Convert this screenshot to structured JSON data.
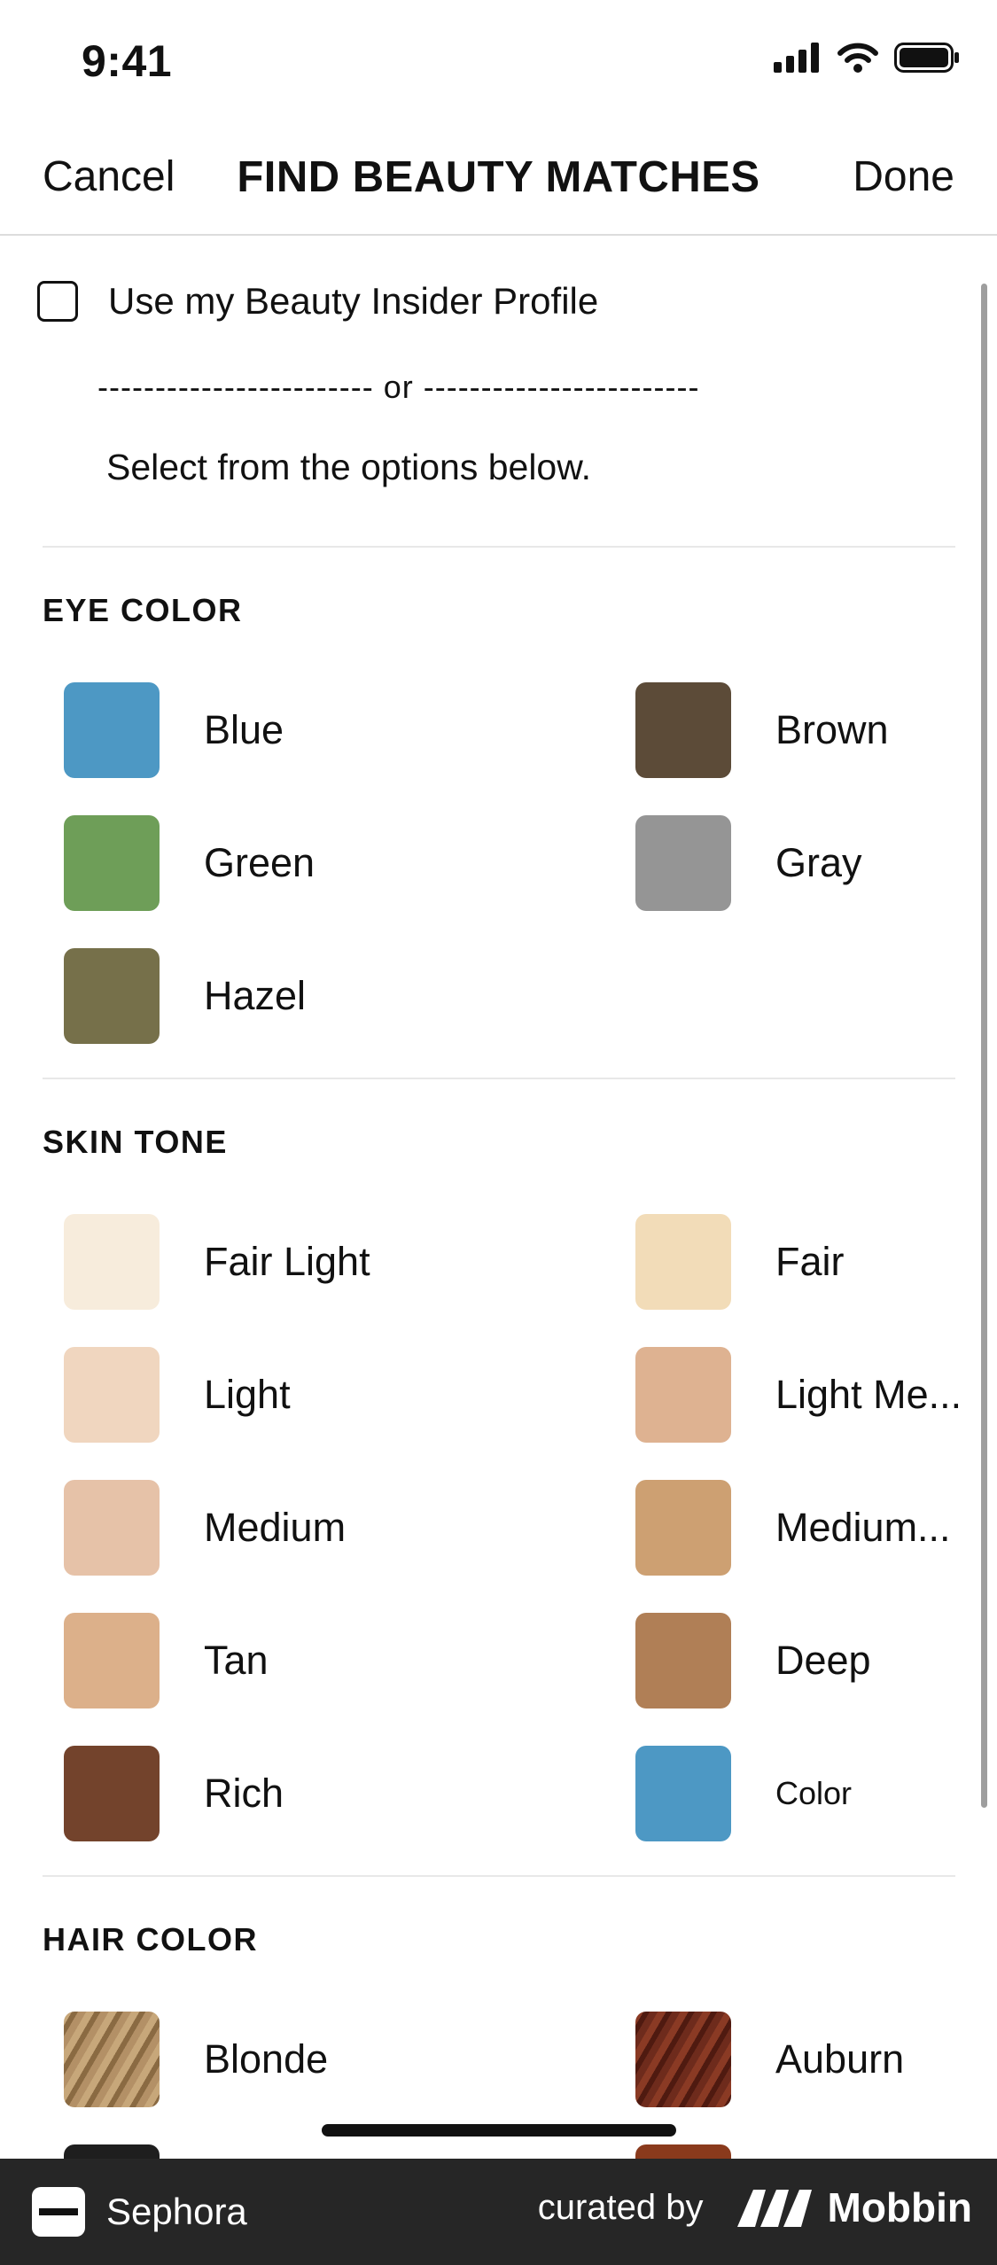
{
  "status_bar": {
    "time": "9:41"
  },
  "nav": {
    "cancel": "Cancel",
    "title": "FIND BEAUTY MATCHES",
    "done": "Done"
  },
  "profile": {
    "checkbox_label": "Use my Beauty Insider Profile",
    "divider_text": "------------------------ or ------------------------",
    "instruction": "Select from the options below."
  },
  "eye_color": {
    "title": "EYE COLOR",
    "options": [
      {
        "label": "Blue",
        "color": "#4d98c4"
      },
      {
        "label": "Brown",
        "color": "#5c4b38"
      },
      {
        "label": "Green",
        "color": "#6e9e58"
      },
      {
        "label": "Gray",
        "color": "#959595"
      },
      {
        "label": "Hazel",
        "color": "#76704a"
      }
    ]
  },
  "skin_tone": {
    "title": "SKIN TONE",
    "options": [
      {
        "label": "Fair Light",
        "color": "#f7ecdc"
      },
      {
        "label": "Fair",
        "color": "#f2dcb8"
      },
      {
        "label": "Light",
        "color": "#f0d6bf"
      },
      {
        "label": "Light Me...",
        "color": "#deb291"
      },
      {
        "label": "Medium",
        "color": "#e6c2a8"
      },
      {
        "label": "Medium...",
        "color": "#cda072"
      },
      {
        "label": "Tan",
        "color": "#dcb08a"
      },
      {
        "label": "Deep",
        "color": "#b07f56"
      },
      {
        "label": "Rich",
        "color": "#73432c"
      },
      {
        "label": "Color",
        "color": "#4d98c4"
      }
    ]
  },
  "hair_color": {
    "title": "HAIR COLOR",
    "options": [
      {
        "label": "Blonde",
        "color": "#a8875c"
      },
      {
        "label": "Auburn",
        "color": "#6e2b1c"
      }
    ]
  },
  "footer": {
    "brand": "Sephora",
    "curated_by": "curated by",
    "mobbin": "Mobbin"
  }
}
